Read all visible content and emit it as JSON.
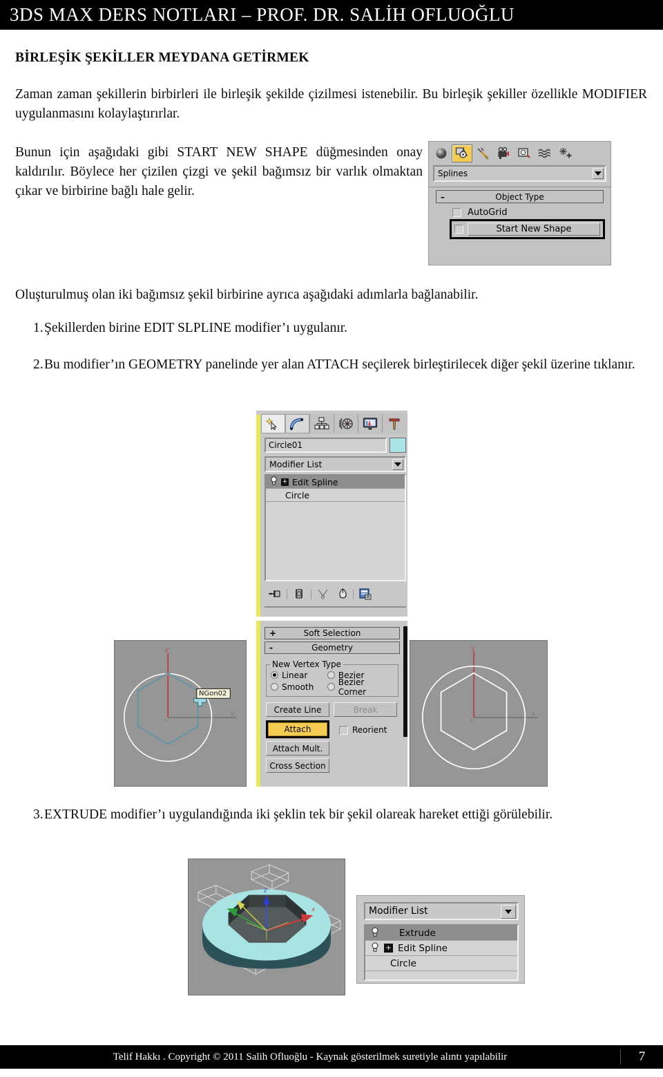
{
  "header": {
    "title": "3DS MAX DERS NOTLARI – PROF. DR. SALİH OFLUOĞLU"
  },
  "section_title": "BİRLEŞİK ŞEKİLLER MEYDANA GETİRMEK",
  "paragraphs": {
    "p1": "Zaman zaman  şekillerin birbirleri ile birleşik şekilde çizilmesi istenebilir. Bu birleşik şekiller özellikle MODIFIER uygulanmasını kolaylaştırırlar.",
    "p2": "Bunun için aşağıdaki gibi START NEW SHAPE düğmesinden onay kaldırılır. Böylece her çizilen çizgi ve şekil bağımsız bir varlık olmaktan çıkar ve birbirine bağlı hale gelir.",
    "p3": "Oluşturulmuş olan iki bağımsız şekil birbirine ayrıca aşağıdaki adımlarla bağlanabilir."
  },
  "steps": [
    {
      "num": "1.",
      "text": "Şekillerden birine EDIT SLPLINE modifier’ı uygulanır."
    },
    {
      "num": "2.",
      "text": "Bu modifier’ın GEOMETRY panelinde yer alan ATTACH seçilerek birleştirilecek diğer şekil üzerine tıklanır."
    },
    {
      "num": "3.",
      "text": "EXTRUDE modifier’ı uygulandığında iki şeklin tek bir şekil olareak hareket ettiği görülebilir."
    }
  ],
  "panel_splines": {
    "tabs": [
      "create-sphere-icon",
      "shapes-icon",
      "lights-icon",
      "cameras-icon",
      "helpers-icon",
      "space-warps-icon",
      "systems-icon"
    ],
    "category_dropdown": "Splines",
    "rollout": "Object Type",
    "checkboxes": [
      {
        "label": "AutoGrid",
        "checked": false,
        "highlighted": false
      },
      {
        "label": "Start New Shape",
        "checked": false,
        "highlighted": true
      }
    ]
  },
  "panel_modify": {
    "tabs": [
      "create-icon",
      "modify-icon",
      "hierarchy-icon",
      "motion-icon",
      "display-icon",
      "utilities-icon"
    ],
    "object_name": "Circle01",
    "object_color": "#a8e4e4",
    "modifier_list_label": "Modifier List",
    "stack": [
      {
        "label": "Edit Spline",
        "selected": true,
        "expandable": true
      },
      {
        "label": "Circle",
        "selected": false,
        "expandable": false
      }
    ],
    "stack_tools": [
      "pin-stack-icon",
      "show-end-result-icon",
      "make-unique-icon",
      "remove-modifier-icon",
      "configure-modifier-sets-icon"
    ],
    "rollouts": [
      {
        "label": "Soft Selection",
        "state": "+"
      },
      {
        "label": "Geometry",
        "state": "-"
      }
    ],
    "new_vertex_type": {
      "group_label": "New Vertex Type",
      "options": [
        {
          "label": "Linear",
          "selected": true
        },
        {
          "label": "Bezier",
          "selected": false
        },
        {
          "label": "Smooth",
          "selected": false
        },
        {
          "label": "Bezier Corner",
          "selected": false
        }
      ]
    },
    "buttons": [
      {
        "label": "Create Line",
        "state": "normal"
      },
      {
        "label": "Break",
        "state": "disabled"
      },
      {
        "label": "Attach",
        "state": "active"
      },
      {
        "label": "Attach Mult.",
        "state": "normal"
      },
      {
        "label": "Cross Section",
        "state": "normal"
      }
    ],
    "reorient": {
      "label": "Reorient",
      "checked": false
    }
  },
  "viewport_left": {
    "tooltip": "NGon02",
    "axis_y": "y",
    "axis_x": "x",
    "axis_z": "z",
    "background": "#969696",
    "circle_color": "#ffffff",
    "hexagon_color": "#5b93a8"
  },
  "viewport_right": {
    "axis_y": "y",
    "axis_x": "x",
    "axis_z": "z",
    "background": "#969696",
    "circle_color": "#ffffff",
    "hexagon_color": "#ffffff"
  },
  "viewport_extrude": {
    "background": "#969696",
    "object_color": "#a8e4e4",
    "axis_z_label": "z",
    "axis_x_label": "x"
  },
  "panel_extrude": {
    "modifier_list_label": "Modifier List",
    "stack": [
      {
        "label": "Extrude",
        "selected": true,
        "expandable": false
      },
      {
        "label": "Edit Spline",
        "selected": false,
        "expandable": true
      },
      {
        "label": "Circle",
        "selected": false,
        "expandable": false
      }
    ]
  },
  "footer": {
    "copyright": "Telif Hakkı . Copyright © 2011 Salih Ofluoğlu - Kaynak gösterilmek suretiyle alıntı yapılabilir",
    "page": "7"
  }
}
